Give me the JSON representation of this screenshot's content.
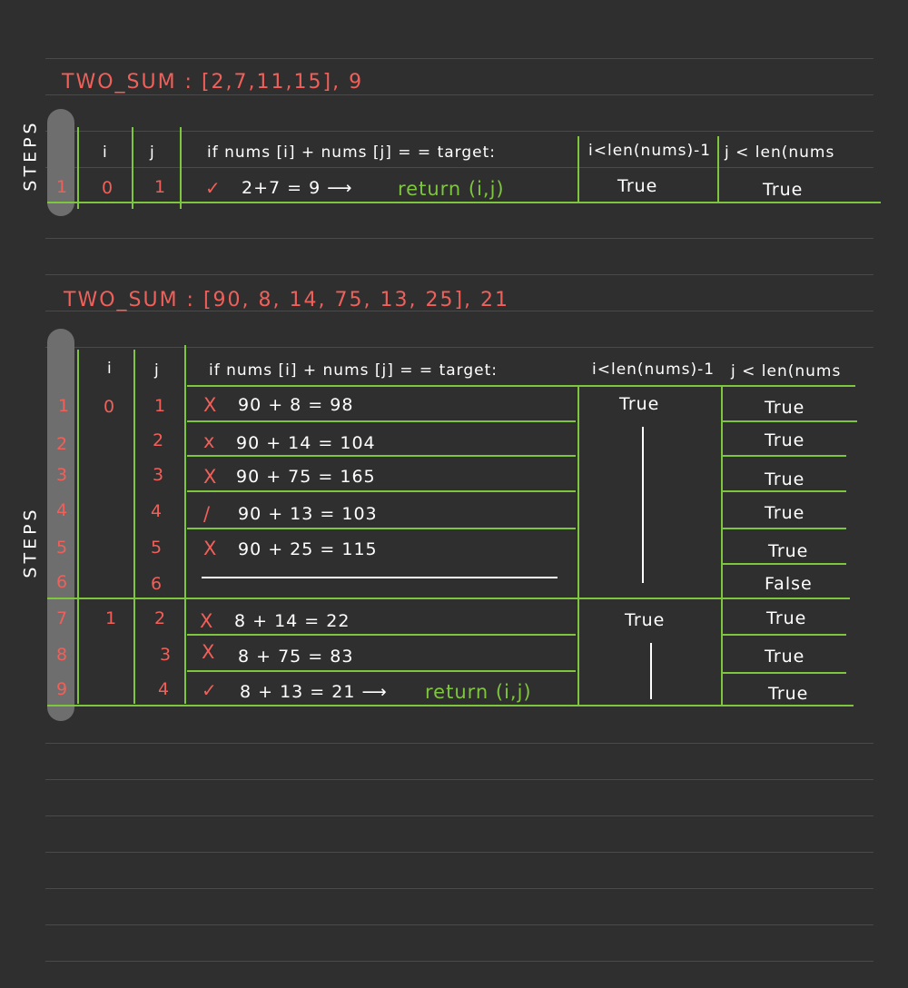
{
  "table1": {
    "title": "TWO_SUM : [2,7,11,15], 9",
    "side_label": "STEPS",
    "headers": {
      "i": "i",
      "j": "j",
      "condition": "if nums [i] + nums [j] = = target:",
      "i_cond": "i<len(nums)-1",
      "j_cond": "j < len(nums"
    },
    "rows": [
      {
        "step": "1",
        "i": "0",
        "j": "1",
        "mark": "✓",
        "expr": "2+7 = 9 ⟶",
        "ret": "return (i,j)",
        "i_cond": "True",
        "j_cond": "True"
      }
    ]
  },
  "table2": {
    "title": "TWO_SUM : [90, 8, 14, 75, 13, 25], 21",
    "side_label": "STEPS",
    "headers": {
      "i": "i",
      "j": "j",
      "condition": "if nums [i] + nums [j] = = target:",
      "i_cond": "i<len(nums)-1",
      "j_cond": "j < len(nums"
    },
    "rows": [
      {
        "step": "1",
        "i": "0",
        "j": "1",
        "mark": "X",
        "expr": "90 + 8 = 98",
        "ret": "",
        "i_cond": "True",
        "j_cond": "True"
      },
      {
        "step": "2",
        "i": "",
        "j": "2",
        "mark": "x",
        "expr": "90 + 14 = 104",
        "ret": "",
        "i_cond": "",
        "j_cond": "True"
      },
      {
        "step": "3",
        "i": "",
        "j": "3",
        "mark": "X",
        "expr": "90 + 75 = 165",
        "ret": "",
        "i_cond": "",
        "j_cond": "True"
      },
      {
        "step": "4",
        "i": "",
        "j": "4",
        "mark": "/",
        "expr": "90 + 13 = 103",
        "ret": "",
        "i_cond": "",
        "j_cond": "True"
      },
      {
        "step": "5",
        "i": "",
        "j": "5",
        "mark": "X",
        "expr": "90 + 25 = 115",
        "ret": "",
        "i_cond": "",
        "j_cond": "True"
      },
      {
        "step": "6",
        "i": "",
        "j": "6",
        "mark": "",
        "expr": "",
        "ret": "",
        "i_cond": "",
        "j_cond": "False"
      },
      {
        "step": "7",
        "i": "1",
        "j": "2",
        "mark": "X",
        "expr": "8 + 14 = 22",
        "ret": "",
        "i_cond": "True",
        "j_cond": "True"
      },
      {
        "step": "8",
        "i": "",
        "j": "3",
        "mark": "X",
        "expr": "8 + 75 = 83",
        "ret": "",
        "i_cond": "",
        "j_cond": "True"
      },
      {
        "step": "9",
        "i": "",
        "j": "4",
        "mark": "✓",
        "expr": "8 + 13 = 21 ⟶",
        "ret": "return (i,j)",
        "i_cond": "",
        "j_cond": "True"
      }
    ]
  },
  "colors": {
    "background": "#2f2f2f",
    "ruled_line": "#4a4a4a",
    "grid_green": "#7ec63d",
    "accent_red": "#f0605a",
    "text_white": "#ffffff"
  }
}
